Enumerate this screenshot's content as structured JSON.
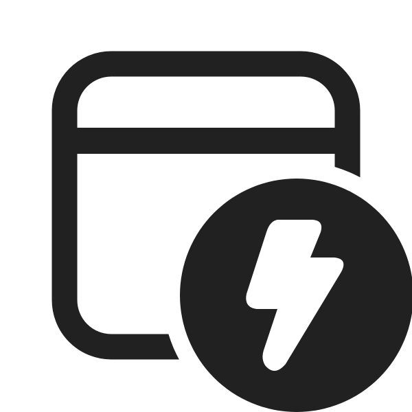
{
  "icon": {
    "name": "window-flash-icon",
    "components": [
      "app-window-icon",
      "lightning-bolt-badge-icon"
    ]
  },
  "colors": {
    "background": "#ffffff",
    "foreground": "#212121",
    "bolt": "#ffffff"
  }
}
